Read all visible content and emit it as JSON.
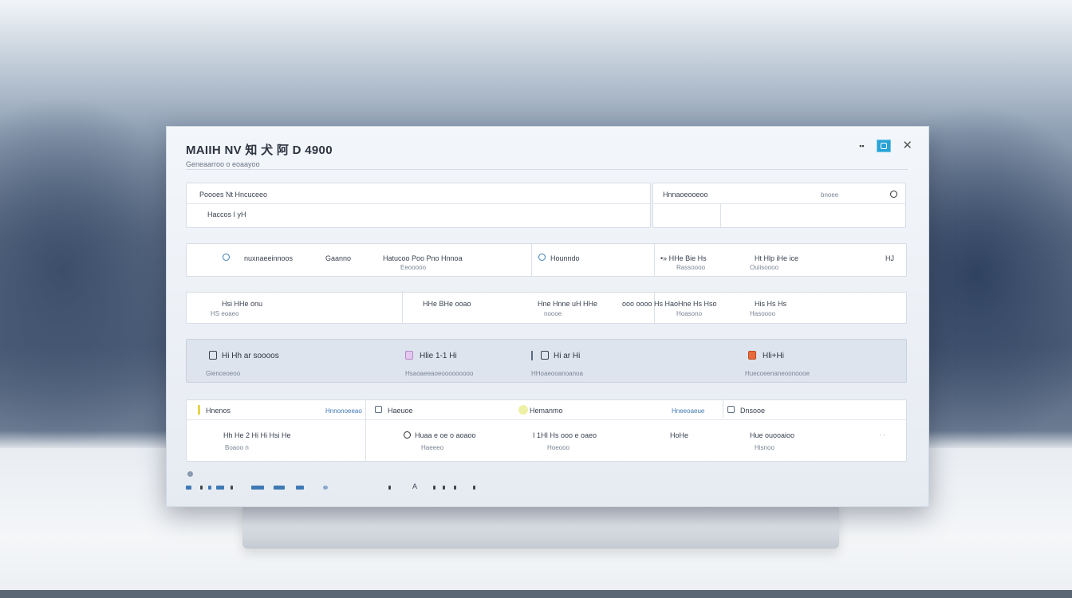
{
  "window": {
    "title": "MAIIH NV 知 犬 阿 D 4900",
    "subtitle": "Geneaarroo o eoaayoo"
  },
  "header_panel": {
    "left_label": "Poooes Nt Hncuceeo",
    "left_value": "Haccos I yH",
    "right_label": "Hnnaoeooeoo",
    "right_meta": "bnoee"
  },
  "row1": {
    "cells": [
      {
        "label": "nuxnaeeinnoos",
        "sub": ""
      },
      {
        "label": "Gaanno",
        "sub": ""
      },
      {
        "label": "Hatucoo Poo Pno Hnnoa",
        "sub": "Eeooooo"
      },
      {
        "label": "Hounndo",
        "sub": ""
      },
      {
        "label": "•» HHe Bie Hs",
        "sub": "Rassoooo"
      },
      {
        "label": "Ht Hlp iHe ice",
        "sub": "Ouiisoooo"
      },
      {
        "label": "HJ",
        "sub": ""
      }
    ]
  },
  "row2": {
    "cells": [
      {
        "label": "Hsi HHe onu",
        "sub": "HS eoaeo"
      },
      {
        "label": "HHe BHe ooao",
        "sub": ""
      },
      {
        "label": "Hne Hnne uH HHe",
        "sub": ""
      },
      {
        "label": "ooo oooo Hs Hao",
        "sub": "noooe"
      },
      {
        "label": "Hne Hs Hso",
        "sub": "Hoasono"
      },
      {
        "label": "His Hs Hs",
        "sub": "Hasoooo"
      }
    ]
  },
  "row3": {
    "cells": [
      {
        "label": "Hi Hh ar soooos",
        "sub": "Gienceoeoo"
      },
      {
        "label": "Hlie 1-1 Hi",
        "sub": "Hsaoaeeaoeooooooooo"
      },
      {
        "label": "Hi ar Hi",
        "sub": "HHoaeooanoanoa"
      },
      {
        "label": "Hli+Hi",
        "sub": "Huecoeenaneoonoooe"
      }
    ],
    "colors": [
      "#3a4250",
      "#c9a7d8",
      "#3a4250",
      "#e56a3c"
    ]
  },
  "table": {
    "headers": [
      {
        "label": "Hnenos",
        "extra": "Hnnonoeeao"
      },
      {
        "label": "Haeuoe",
        "extra": ""
      },
      {
        "label": "Hemanmo",
        "extra": "Hneeoaeue"
      },
      {
        "label": "Dnsooe",
        "extra": ""
      }
    ],
    "rows": [
      {
        "label": "Hh He 2 Hi Hi Hsi He",
        "sub": "Boaoo n"
      },
      {
        "label": "Huaa e oe o aoaoo",
        "sub": "Haeeeo"
      },
      {
        "label": "I 1HI Hs ooo e oaeo",
        "sub": "Hoeooo"
      },
      {
        "label": "HoHe",
        "sub": ""
      },
      {
        "label": "Hue ouooaioo",
        "sub": "Hisnoo"
      }
    ]
  },
  "footer": {
    "mark": "A"
  }
}
